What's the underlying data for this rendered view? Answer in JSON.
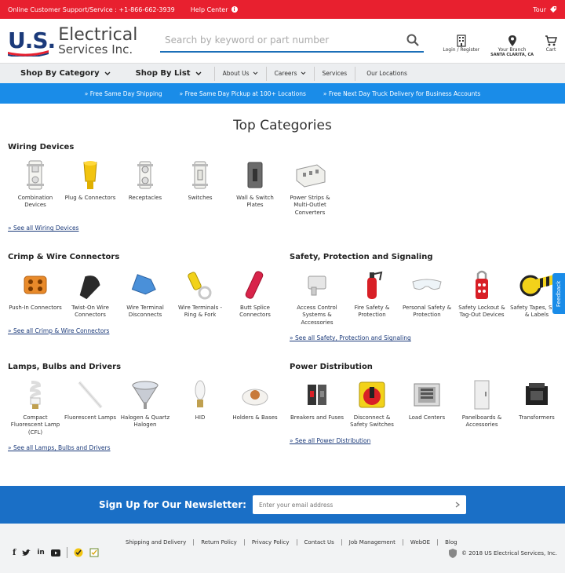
{
  "topbar": {
    "support": "Online Customer Support/Service : +1-866-662-3939",
    "help": "Help Center",
    "tour": "Tour"
  },
  "logo": {
    "us": "U.S.",
    "line1": "Electrical",
    "line2": "Services Inc."
  },
  "search": {
    "placeholder": "Search by keyword or part number"
  },
  "header_icons": {
    "login": "Login / Register",
    "branch": "Your Branch",
    "branch_city": "SANTA CLARITA, CA",
    "cart": "Cart"
  },
  "nav": {
    "shop_category": "Shop By Category",
    "shop_list": "Shop By List",
    "about": "About Us",
    "careers": "Careers",
    "services": "Services",
    "locations": "Our Locations"
  },
  "promo": [
    "Free Same Day Shipping",
    "Free Same Day Pickup at 100+ Locations",
    "Free Next Day Truck Delivery for Business Accounts"
  ],
  "page_title": "Top Categories",
  "sections": {
    "wiring": {
      "title": "Wiring Devices",
      "items": [
        "Combination Devices",
        "Plug & Connectors",
        "Receptacles",
        "Switches",
        "Wall & Switch Plates",
        "Power Strips & Multi-Outlet Converters"
      ],
      "see_all": "See all Wiring Devices"
    },
    "crimp": {
      "title": "Crimp & Wire Connectors",
      "items": [
        "Push-In Connectors",
        "Twist-On Wire Connectors",
        "Wire Terminal Disconnects",
        "Wire Terminals - Ring & Fork",
        "Butt Splice Connectors"
      ],
      "see_all": "See all Crimp & Wire Connectors"
    },
    "safety": {
      "title": "Safety, Protection and Signaling",
      "items": [
        "Access Control Systems & Accessories",
        "Fire Safety & Protection",
        "Personal Safety & Protection",
        "Safety Lockout & Tag-Out Devices",
        "Safety Tapes, Signs & Labels"
      ],
      "see_all": "See all Safety, Protection and Signaling"
    },
    "lamps": {
      "title": "Lamps, Bulbs and Drivers",
      "items": [
        "Compact Fluorescent Lamp (CFL)",
        "Fluorescent Lamps",
        "Halogen & Quartz Halogen",
        "HID",
        "Holders & Bases"
      ],
      "see_all": "See all Lamps, Bulbs and Drivers"
    },
    "power": {
      "title": "Power Distribution",
      "items": [
        "Breakers and Fuses",
        "Disconnect & Safety Switches",
        "Load Centers",
        "Panelboards & Accessories",
        "Transformers"
      ],
      "see_all": "See all Power Distribution"
    }
  },
  "feedback": "Feedback",
  "newsletter": {
    "label": "Sign Up for Our Newsletter:",
    "placeholder": "Enter your email address"
  },
  "footer": {
    "links": [
      "Shipping and Delivery",
      "Return Policy",
      "Privacy Policy",
      "Contact Us",
      "Job Management",
      "WebOE",
      "Blog"
    ],
    "copyright": "© 2018 US Electrical Services, Inc."
  },
  "colors": {
    "red": "#e8202f",
    "blue": "#1a8ce8",
    "navy": "#1b3a7a",
    "newsletter": "#1a6fc6"
  }
}
